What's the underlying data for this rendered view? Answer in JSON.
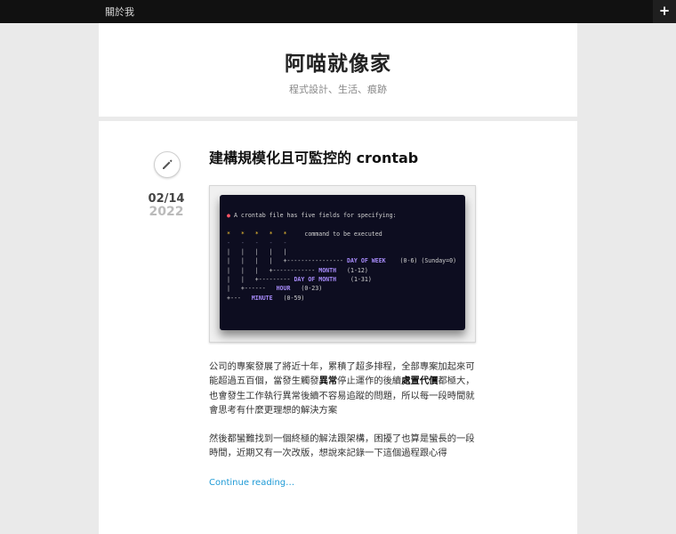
{
  "topbar": {
    "nav_label": "關於我",
    "toggle_label": "+"
  },
  "header": {
    "site_title": "阿喵就像家",
    "site_description": "程式設計、生活、痕跡"
  },
  "post": {
    "format_icon": "pencil-icon",
    "date_md": "02/14",
    "date_year": "2022",
    "title": "建構規模化且可監控的 crontab",
    "terminal": {
      "line1": "A crontab file has five fields for specifying:",
      "stars": "*   *   *   *   *",
      "command": "command to be executed",
      "field_dow": "DAY OF WEEK",
      "range_dow": "(0-6) (Sunday=0)",
      "field_month": "MONTH",
      "range_month": "(1-12)",
      "field_dom": "DAY OF MONTH",
      "range_dom": "(1-31)",
      "field_hour": "HOUR",
      "range_hour": "(0-23)",
      "field_minute": "MINUTE",
      "range_minute": "(0-59)"
    },
    "para1": {
      "t1": "公司的專案發展了將近十年，累積了超多排程，全部專案加起來可能超過五百個，當發生觸發",
      "b1": "異常",
      "t2": "停止運作的後續",
      "b2": "處置代價",
      "t3": "都極大，也會發生工作執行異常後續不容易追蹤的問題，所以每一段時間就會思考有什麼更理想的解決方案"
    },
    "para2": "然後都蠻難找到一個終極的解法跟架構，困擾了也算是蠻長的一段時間，近期又有一次改版，想說來記錄一下這個過程跟心得",
    "more_label": "Continue reading…"
  },
  "colors": {
    "accent_link": "#1e9ad6",
    "topbar_bg": "#111111",
    "terminal_bg": "#0d0d20",
    "terminal_field": "#a78bfa",
    "terminal_star": "#ffcc33"
  }
}
